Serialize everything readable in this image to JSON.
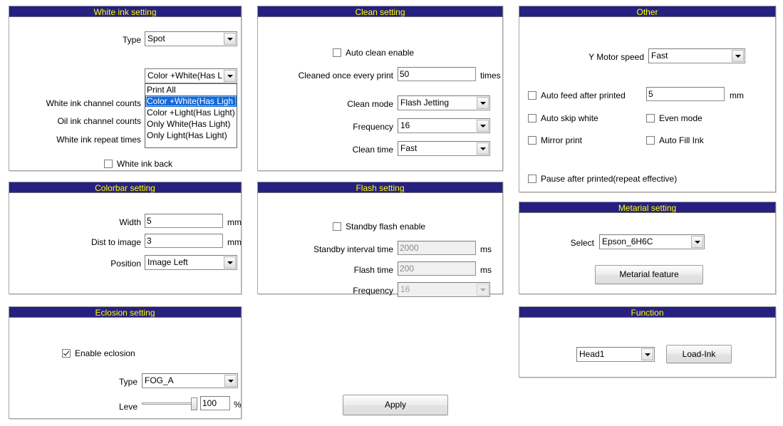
{
  "white_ink": {
    "title": "White ink setting",
    "type_label": "Type",
    "type_value": "Spot",
    "mode_value": "Color +White(Has L",
    "mode_options": [
      "Print All",
      "Color +White(Has Ligh",
      "Color +Light(Has Light)",
      "Only White(Has Light)",
      "Only Light(Has Light)"
    ],
    "mode_selected_index": 1,
    "white_channel_counts_label": "White ink channel counts",
    "oil_channel_counts_label": "Oil ink channel counts",
    "white_repeat_times_label": "White ink repeat times",
    "white_ink_back_label": "White ink back",
    "white_ink_back_checked": false
  },
  "clean": {
    "title": "Clean setting",
    "auto_clean_label": "Auto clean enable",
    "auto_clean_checked": false,
    "cleaned_every_label": "Cleaned once every print",
    "cleaned_every_value": "50",
    "cleaned_every_unit": "times",
    "clean_mode_label": "Clean mode",
    "clean_mode_value": "Flash Jetting",
    "frequency_label": "Frequency",
    "frequency_value": "16",
    "clean_time_label": "Clean time",
    "clean_time_value": "Fast"
  },
  "other": {
    "title": "Other",
    "y_motor_label": "Y Motor speed",
    "y_motor_value": "Fast",
    "auto_feed_label": "Auto feed after printed",
    "auto_feed_checked": false,
    "auto_feed_value": "5",
    "auto_feed_unit": "mm",
    "auto_skip_white_label": "Auto skip white",
    "auto_skip_white_checked": false,
    "even_mode_label": "Even mode",
    "even_mode_checked": false,
    "mirror_print_label": "Mirror print",
    "mirror_print_checked": false,
    "auto_fill_ink_label": "Auto Fill Ink",
    "auto_fill_ink_checked": false,
    "pause_after_label": "Pause after printed(repeat effective)",
    "pause_after_checked": false
  },
  "colorbar": {
    "title": "Colorbar setting",
    "width_label": "Width",
    "width_value": "5",
    "width_unit": "mm",
    "dist_label": "Dist to image",
    "dist_value": "3",
    "dist_unit": "mm",
    "position_label": "Position",
    "position_value": "Image Left"
  },
  "flash": {
    "title": "Flash setting",
    "standby_enable_label": "Standby flash enable",
    "standby_enable_checked": false,
    "standby_interval_label": "Standby interval time",
    "standby_interval_value": "2000",
    "standby_interval_unit": "ms",
    "flash_time_label": "Flash time",
    "flash_time_value": "200",
    "flash_time_unit": "ms",
    "frequency_label": "Frequency",
    "frequency_value": "16"
  },
  "metarial": {
    "title": "Metarial setting",
    "select_label": "Select",
    "select_value": "Epson_6H6C",
    "feature_button": "Metarial feature"
  },
  "eclosion": {
    "title": "Eclosion setting",
    "enable_label": "Enable eclosion",
    "enable_checked": true,
    "type_label": "Type",
    "type_value": "FOG_A",
    "level_label": "Leve",
    "level_value": "100",
    "level_unit": "%",
    "level_percent": 100
  },
  "function": {
    "title": "Function",
    "head_value": "Head1",
    "load_ink_button": "Load-Ink"
  },
  "apply_button": "Apply",
  "colors": {
    "title_bar": "#262080",
    "title_text": "#ffff00",
    "highlight": "#1669d6"
  }
}
